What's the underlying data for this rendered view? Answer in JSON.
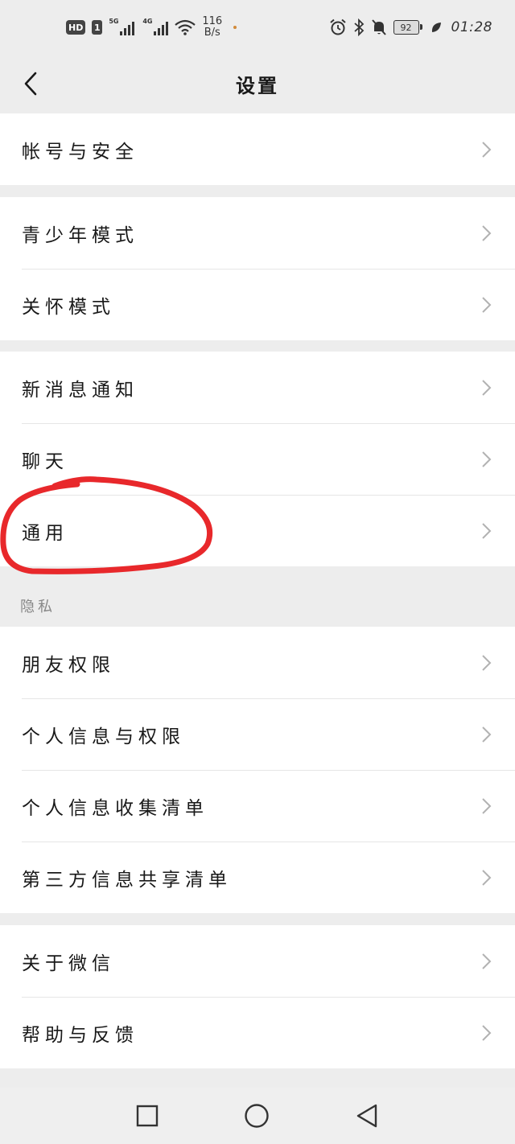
{
  "status_bar": {
    "hd_label": "HD",
    "sim_label": "1",
    "signal1_tag": "5G",
    "signal2_tag": "4G",
    "net_speed_value": "116",
    "net_speed_unit": "B/s",
    "battery_level": "92",
    "time": "01:28"
  },
  "header": {
    "title": "设置"
  },
  "groups": [
    {
      "items": [
        {
          "label": "帐号与安全"
        }
      ]
    },
    {
      "items": [
        {
          "label": "青少年模式"
        },
        {
          "label": "关怀模式"
        }
      ]
    },
    {
      "items": [
        {
          "label": "新消息通知"
        },
        {
          "label": "聊天"
        },
        {
          "label": "通用"
        }
      ]
    },
    {
      "section_label": "隐私",
      "items": [
        {
          "label": "朋友权限"
        },
        {
          "label": "个人信息与权限"
        },
        {
          "label": "个人信息收集清单"
        },
        {
          "label": "第三方信息共享清单"
        }
      ]
    },
    {
      "items": [
        {
          "label": "关于微信"
        },
        {
          "label": "帮助与反馈"
        }
      ]
    }
  ],
  "annotation_color": "#e8282b",
  "icons": [
    "back-arrow-icon",
    "chevron-right-icon",
    "recent-apps-icon",
    "home-icon",
    "back-triangle-icon",
    "alarm-icon",
    "bluetooth-icon",
    "mute-bell-icon",
    "wifi-icon",
    "leaf-icon"
  ]
}
